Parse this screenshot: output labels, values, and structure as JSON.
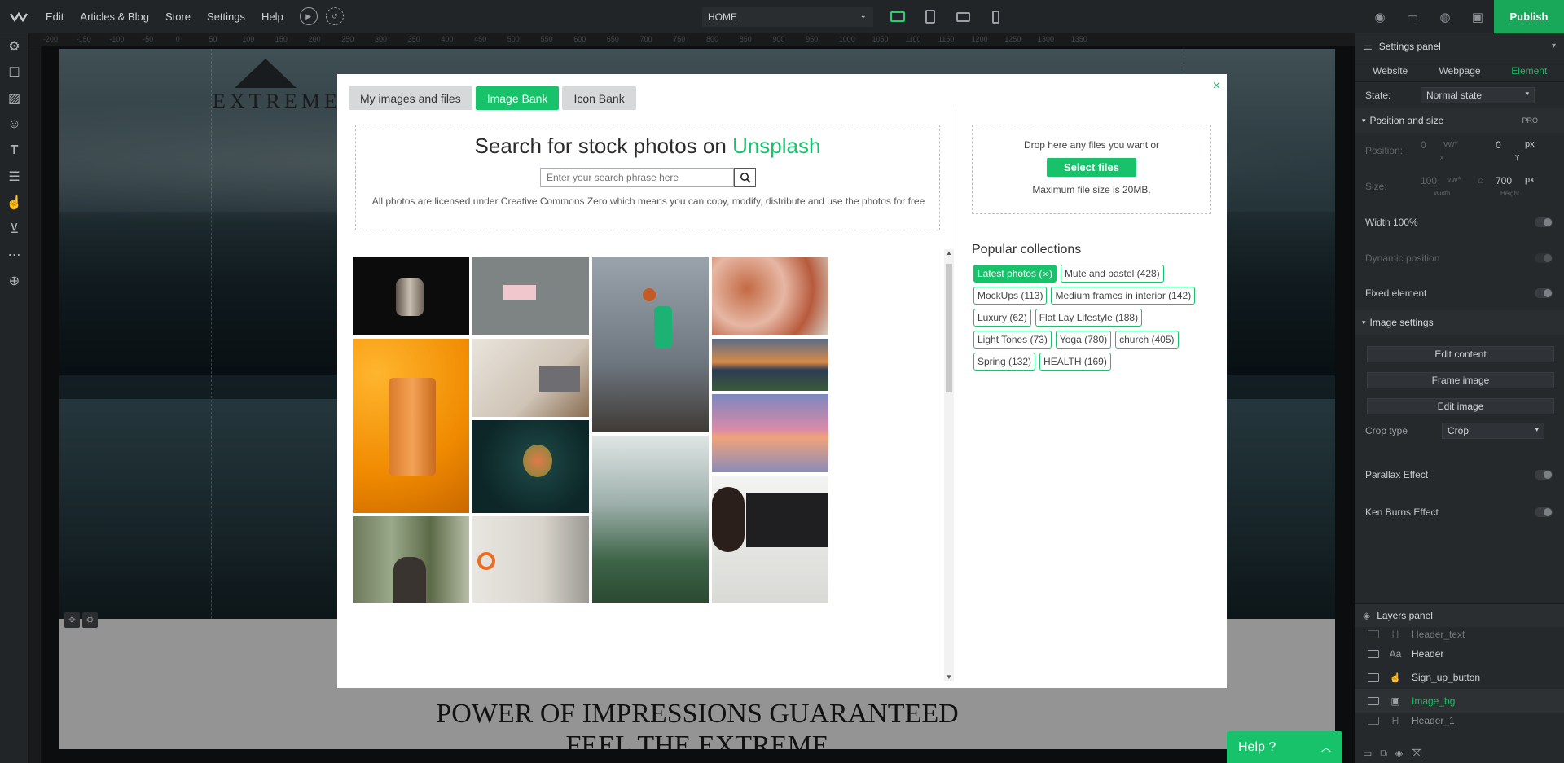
{
  "topbar": {
    "menu": [
      "Edit",
      "Articles & Blog",
      "Store",
      "Settings",
      "Help"
    ],
    "page_select": "HOME",
    "publish_label": "Publish"
  },
  "ruler": {
    "ticks": [
      "-200",
      "-150",
      "-100",
      "-50",
      "0",
      "50",
      "100",
      "150",
      "200",
      "250",
      "300",
      "350",
      "400",
      "450",
      "500",
      "550",
      "600",
      "650",
      "700",
      "750",
      "800",
      "850",
      "900",
      "950",
      "1000",
      "1050",
      "1100",
      "1150",
      "1200",
      "1250",
      "1300",
      "1350"
    ]
  },
  "site": {
    "logo_text": "EXTREME",
    "tagline_1": "POWER OF IMPRESSIONS GUARANTEED",
    "tagline_2": "FEEL THE EXTREME"
  },
  "modal": {
    "tabs": [
      "My images and files",
      "Image Bank",
      "Icon Bank"
    ],
    "active_tab": 1,
    "close": "×",
    "search_title": "Search for stock photos on",
    "search_brand": "Unsplash",
    "search_placeholder": "Enter your search phrase here",
    "license_text": "All photos are licensed under Creative Commons Zero which means you can copy, modify, distribute and use the photos for free",
    "drop_text": "Drop here any files you want or",
    "select_files": "Select files",
    "max_size": "Maximum file size is 20MB.",
    "popular_title": "Popular collections",
    "collections": [
      [
        "Latest photos (∞)",
        "Mute and pastel (428)"
      ],
      [
        "MockUps (113)",
        "Medium frames in interior (142)"
      ],
      [
        "Luxury (62)",
        "Flat Lay Lifestyle (188)"
      ],
      [
        "Light Tones (73)",
        "Yoga (780)",
        "church (405)"
      ],
      [
        "Spring (132)",
        "HEALTH (169)"
      ]
    ],
    "photos": [
      "coins-photo",
      "paper-on-wall-photo",
      "basketball-dunk-photo",
      "food-table-photo",
      "beer-can-oranges-photo",
      "laptop-people-photo",
      "mountain-lake-photo",
      "sunset-sea-photo",
      "flower-bud-photo",
      "greenhouse-photo",
      "computer-desk-photo",
      "forest-man-photo",
      "graffiti-wall-photo"
    ]
  },
  "settings": {
    "title": "Settings panel",
    "tabs": [
      "Website",
      "Webpage",
      "Element"
    ],
    "state_label": "State:",
    "state_value": "Normal state",
    "position_size": "Position and size",
    "pro": "PRO",
    "position_label": "Position:",
    "position_x": "0",
    "position_y": "0",
    "unit_vw": "vw*",
    "unit_px": "px",
    "x_label": "x",
    "y_label": "Y",
    "size_label": "Size:",
    "size_w": "100",
    "size_h": "700",
    "width_label": "Width",
    "height_label": "Height",
    "width100": "Width 100%",
    "dynamic_position": "Dynamic position",
    "fixed_element": "Fixed element",
    "image_settings": "Image settings",
    "edit_content": "Edit content",
    "frame_image": "Frame image",
    "edit_image": "Edit image",
    "crop_type_label": "Crop type",
    "crop_type_value": "Crop",
    "parallax": "Parallax Effect",
    "ken_burns": "Ken Burns Effect"
  },
  "layers": {
    "title": "Layers panel",
    "items": [
      {
        "type": "H",
        "name": "Header_text"
      },
      {
        "type": "Aa",
        "name": "Header"
      },
      {
        "type": "☝",
        "name": "Sign_up_button"
      },
      {
        "type": "▣",
        "name": "Image_bg"
      },
      {
        "type": "H",
        "name": "Header_1"
      }
    ]
  },
  "help": {
    "label": "Help ?"
  },
  "colors": {
    "accent": "#17c26b",
    "panel": "#26292c",
    "topbar": "#222528"
  }
}
